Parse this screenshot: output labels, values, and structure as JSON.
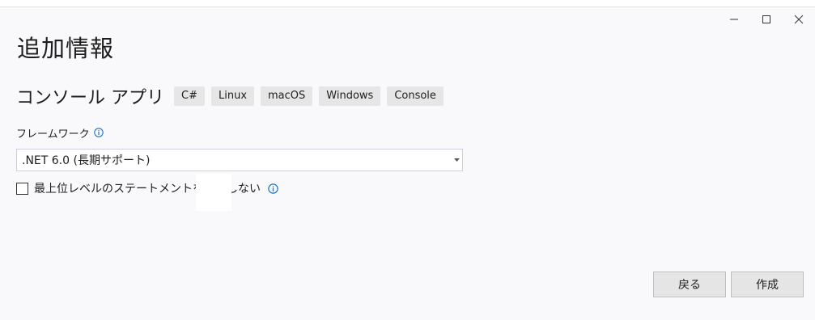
{
  "window": {
    "controls": {
      "minimize_icon": "minimize-icon",
      "maximize_icon": "maximize-icon",
      "close_icon": "close-icon"
    }
  },
  "header": {
    "title": "追加情報"
  },
  "template": {
    "name": "コンソール アプリ",
    "tags": [
      "C#",
      "Linux",
      "macOS",
      "Windows",
      "Console"
    ]
  },
  "framework": {
    "label": "フレームワーク",
    "selected": ".NET 6.0 (長期サポート)"
  },
  "options": {
    "top_level_statements": {
      "label": "最上位レベルのステートメントを使用しない",
      "checked": false
    }
  },
  "footer": {
    "back_label": "戻る",
    "create_label": "作成"
  },
  "colors": {
    "background": "#f9f9fb",
    "button": "#e5e5e5",
    "info_icon": "#1e71c7",
    "tag": "#e6e6e6"
  }
}
